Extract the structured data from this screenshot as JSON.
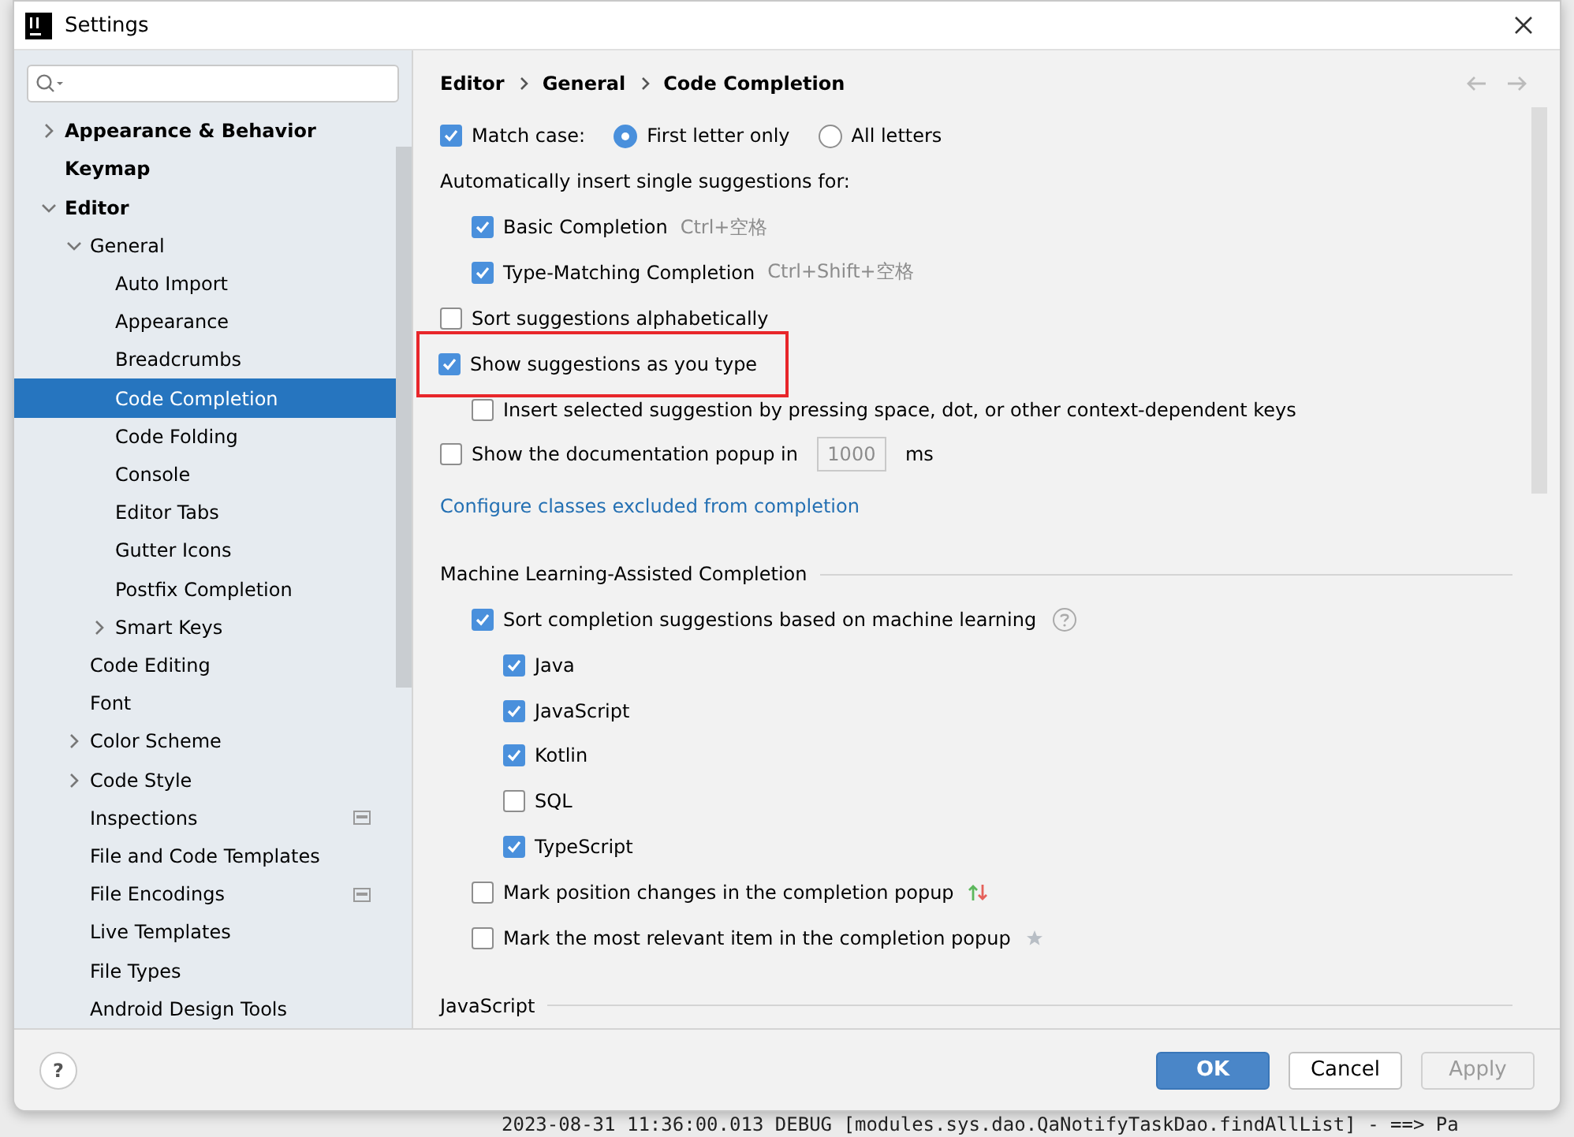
{
  "window": {
    "title": "Settings"
  },
  "sidebar": {
    "items": [
      {
        "label": "Appearance & Behavior",
        "bold": true,
        "expanded": false,
        "expandable": true,
        "selected": false
      },
      {
        "label": "Keymap",
        "bold": true,
        "selected": false
      },
      {
        "label": "Editor",
        "bold": true,
        "expandable": true,
        "expanded": true,
        "selected": false,
        "children": [
          {
            "label": "General",
            "expandable": true,
            "expanded": true,
            "selected": false,
            "children": [
              {
                "label": "Auto Import",
                "selected": false
              },
              {
                "label": "Appearance",
                "selected": false
              },
              {
                "label": "Breadcrumbs",
                "selected": false
              },
              {
                "label": "Code Completion",
                "selected": true
              },
              {
                "label": "Code Folding",
                "selected": false
              },
              {
                "label": "Console",
                "selected": false
              },
              {
                "label": "Editor Tabs",
                "selected": false
              },
              {
                "label": "Gutter Icons",
                "selected": false
              },
              {
                "label": "Postfix Completion",
                "selected": false
              },
              {
                "label": "Smart Keys",
                "expandable": true,
                "expanded": false,
                "selected": false
              }
            ]
          },
          {
            "label": "Code Editing",
            "selected": false
          },
          {
            "label": "Font",
            "selected": false
          },
          {
            "label": "Color Scheme",
            "expandable": true,
            "expanded": false,
            "selected": false
          },
          {
            "label": "Code Style",
            "expandable": true,
            "expanded": false,
            "selected": false
          },
          {
            "label": "Inspections",
            "project_level": true,
            "selected": false
          },
          {
            "label": "File and Code Templates",
            "selected": false
          },
          {
            "label": "File Encodings",
            "project_level": true,
            "selected": false
          },
          {
            "label": "Live Templates",
            "selected": false
          },
          {
            "label": "File Types",
            "selected": false
          },
          {
            "label": "Android Design Tools",
            "selected": false
          }
        ]
      }
    ]
  },
  "breadcrumbs": [
    "Editor",
    "General",
    "Code Completion"
  ],
  "content": {
    "rows": [
      {
        "kind": "match_case",
        "label": "Match case:",
        "checked": true,
        "radios": [
          {
            "label": "First letter only",
            "selected": true
          },
          {
            "label": "All letters",
            "selected": false
          }
        ]
      },
      {
        "kind": "heading",
        "label": "Automatically insert single suggestions for:",
        "children": [
          {
            "kind": "checkbox",
            "label": "Basic Completion",
            "checked": true,
            "shortcut": "Ctrl+空格"
          },
          {
            "kind": "checkbox",
            "label": "Type-Matching Completion",
            "checked": true,
            "shortcut": "Ctrl+Shift+空格"
          }
        ]
      },
      {
        "kind": "checkbox",
        "label": "Sort suggestions alphabetically",
        "checked": false
      },
      {
        "kind": "checkbox",
        "label": "Show suggestions as you type",
        "checked": true,
        "highlighted": true,
        "children": [
          {
            "kind": "checkbox",
            "label": "Insert selected suggestion by pressing space, dot, or other context-dependent keys",
            "checked": false
          }
        ]
      },
      {
        "kind": "popup_delay",
        "label": "Show the documentation popup in",
        "checked": false,
        "value": "1000",
        "unit": "ms"
      },
      {
        "kind": "link",
        "label": "Configure classes excluded from completion"
      },
      {
        "kind": "section",
        "label": "Machine Learning-Assisted Completion",
        "children": [
          {
            "kind": "checkbox",
            "label": "Sort completion suggestions based on machine learning",
            "checked": true,
            "help": true,
            "children": [
              {
                "kind": "checkbox",
                "label": "Java",
                "checked": true
              },
              {
                "kind": "checkbox",
                "label": "JavaScript",
                "checked": true
              },
              {
                "kind": "checkbox",
                "label": "Kotlin",
                "checked": true
              },
              {
                "kind": "checkbox",
                "label": "SQL",
                "checked": false
              },
              {
                "kind": "checkbox",
                "label": "TypeScript",
                "checked": true
              }
            ]
          },
          {
            "kind": "position_marker",
            "label": "Mark position changes in the completion popup",
            "checked": false
          },
          {
            "kind": "relevance_marker",
            "label": "Mark the most relevant item in the completion popup",
            "checked": false
          }
        ]
      },
      {
        "kind": "section",
        "label": "JavaScript"
      }
    ]
  },
  "help_button": "?",
  "buttons": [
    {
      "label": "OK",
      "kind": "primary",
      "disabled": false
    },
    {
      "label": "Cancel",
      "kind": "normal",
      "disabled": false
    },
    {
      "label": "Apply",
      "kind": "normal",
      "disabled": true
    }
  ],
  "background_log": "2023-08-31 11:36:00.013 DEBUG [modules.sys.dao.QaNotifyTaskDao.findAllList] - ==> Pa"
}
